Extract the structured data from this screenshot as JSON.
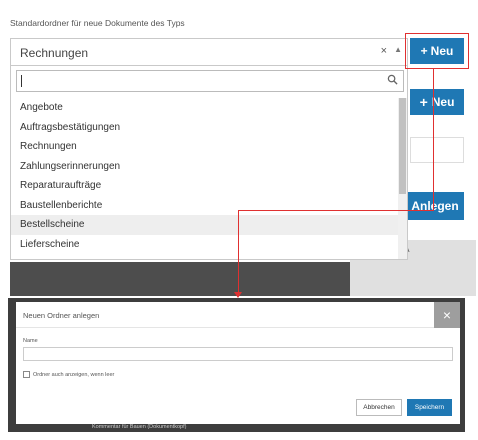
{
  "field": {
    "label": "Standardordner für neue Dokumente des Typs"
  },
  "select": {
    "value": "Rechnungen",
    "clear_glyph": "×",
    "arrow_glyph": "▲"
  },
  "dropdown": {
    "search_value": "",
    "options": [
      "Angebote",
      "Auftragsbestätigungen",
      "Rechnungen",
      "Zahlungserinnerungen",
      "Reparaturaufträge",
      "Baustellenberichte",
      "Bestellscheine",
      "Lieferscheine"
    ],
    "hovered_option": "Bestellscheine"
  },
  "buttons": {
    "neu_plus": "+",
    "neu_label": "Neu",
    "neu2_plus": "+",
    "neu2_label": "Neu",
    "anlegen_label": "Anlegen"
  },
  "background": {
    "partial_text": "ihmen und A"
  },
  "modal": {
    "title": "Neuen Ordner anlegen",
    "close_glyph": "×",
    "name_label": "Name",
    "name_value": "",
    "checkbox_label": "Ordner auch anzeigen, wenn leer",
    "checkbox_checked": false,
    "cancel_label": "Abbrechen",
    "save_label": "Speichern",
    "behind_text": "Kommentar für Bauen (Dokumentkopf)"
  },
  "colors": {
    "accent": "#1f78b4",
    "highlight": "#e03030",
    "hover": "#eeeeee"
  },
  "icons": {
    "search": "search-icon",
    "close": "close-icon",
    "plus": "plus-icon",
    "arrow": "chevron-up-icon"
  }
}
